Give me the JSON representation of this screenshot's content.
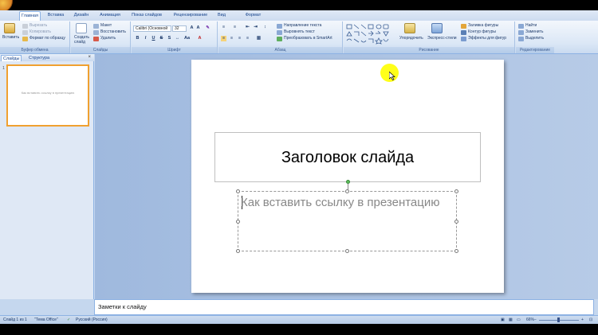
{
  "tabs": [
    "Главная",
    "Вставка",
    "Дизайн",
    "Анимация",
    "Показ слайдов",
    "Рецензирование",
    "Вид",
    "Формат"
  ],
  "ribbon": {
    "clipboard": {
      "paste": "Вставить",
      "cut": "Вырезать",
      "copy": "Копировать",
      "format_painter": "Формат по образцу",
      "caption": "Буфер обмена"
    },
    "slides": {
      "new_slide": "Создать слайд",
      "layout": "Макет",
      "reset": "Восстановить",
      "delete": "Удалить",
      "caption": "Слайды"
    },
    "font": {
      "font_name": "Calibri (Основной",
      "font_size": "32",
      "caption": "Шрифт"
    },
    "paragraph": {
      "text_direction": "Направление текста",
      "align_text": "Выровнять текст",
      "smartart": "Преобразовать в SmartArt",
      "caption": "Абзац"
    },
    "drawing": {
      "arrange": "Упорядочить",
      "quick_styles": "Экспресс-стили",
      "shape_fill": "Заливка фигуры",
      "shape_outline": "Контур фигуры",
      "shape_effects": "Эффекты для фигур",
      "caption": "Рисование"
    },
    "editing": {
      "find": "Найти",
      "replace": "Заменить",
      "select": "Выделить",
      "caption": "Редактирование"
    }
  },
  "left_pane": {
    "tab_slides": "Слайды",
    "tab_outline": "Структура",
    "close": "×",
    "slide_number": "1",
    "thumb_text": "Как вставить ссылку в презентацию"
  },
  "slide": {
    "title": "Заголовок слайда",
    "subtitle": "Как вставить ссылку в презентацию"
  },
  "notes": {
    "placeholder": "Заметки к слайду"
  },
  "status": {
    "slide_info": "Слайд 1 из 1",
    "theme": "\"Тема Office\"",
    "language": "Русский (Россия)",
    "zoom": "66%"
  }
}
